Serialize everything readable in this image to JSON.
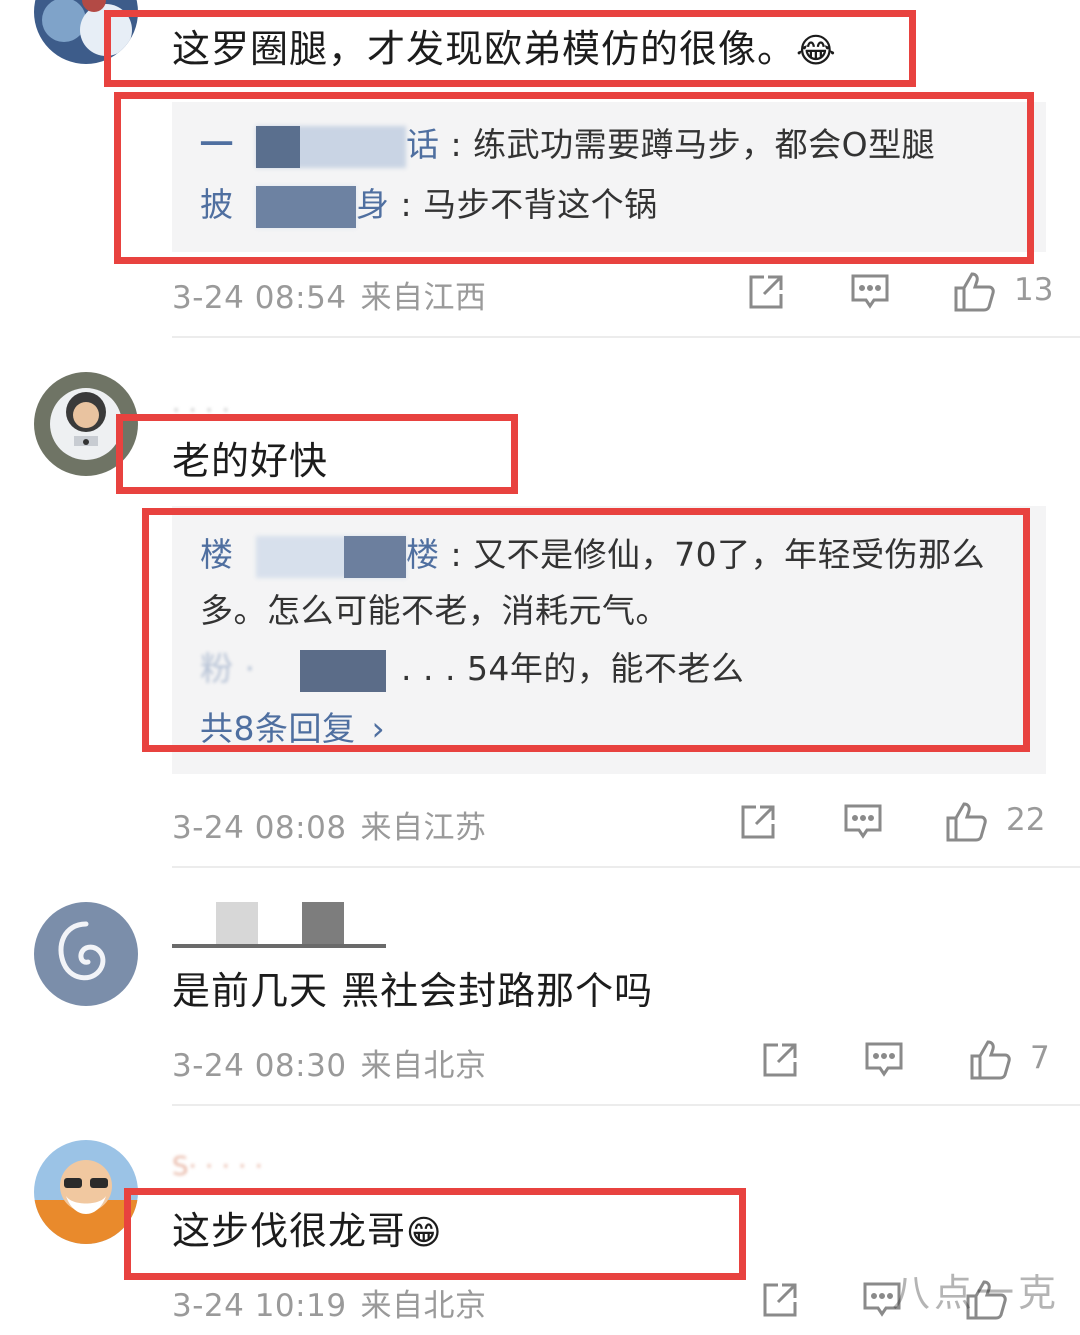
{
  "comments": [
    {
      "text": "这罗圈腿，才发现欧弟模仿的很像。",
      "emoji": "😂",
      "replies": [
        {
          "name_visible": "话",
          "text": ": 练武功需要蹲马步，都会O型腿"
        },
        {
          "name_visible": "身",
          "text": ": 马步不背这个锅"
        }
      ],
      "time": "3-24 08:54",
      "location": "来自江西",
      "likes": "13"
    },
    {
      "text": "老的好快",
      "replies": [
        {
          "name_visible": "楼",
          "text": ": 又不是修仙，70了，年轻受伤那么"
        },
        {
          "name_visible": "",
          "text": "多。怎么可能不老，消耗元气。"
        },
        {
          "name_visible": "",
          "text": ". . . 54年的，能不老么"
        }
      ],
      "more_replies": "共8条回复",
      "time": "3-24 08:08",
      "location": "来自江苏",
      "likes": "22"
    },
    {
      "text": "是前几天 黑社会封路那个吗",
      "time": "3-24 08:30",
      "location": "来自北京",
      "likes": "7"
    },
    {
      "text": "这步伐很龙哥",
      "emoji": "😁",
      "time": "3-24 10:19",
      "location": "来自北京"
    }
  ],
  "watermark": "八点一克",
  "colors": {
    "highlight_border": "#e8423f",
    "reply_name": "#4f6fa0",
    "meta_gray": "#9a9a9a",
    "reply_bg": "#f4f4f5"
  },
  "icons": [
    "share-icon",
    "comment-icon",
    "like-icon"
  ]
}
